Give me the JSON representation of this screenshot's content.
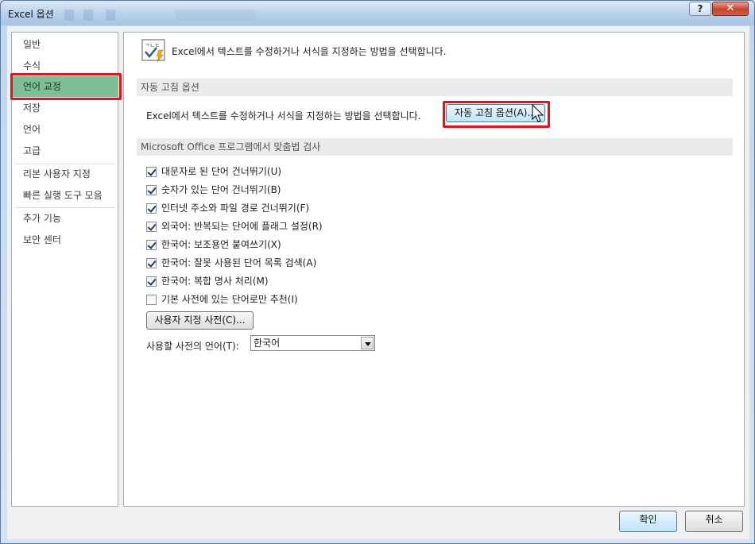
{
  "window": {
    "title": "Excel 옵션",
    "help_glyph": "?",
    "close_glyph": "✕"
  },
  "nav": {
    "items": [
      {
        "label": "일반"
      },
      {
        "label": "수식"
      },
      {
        "label": "언어 교정",
        "selected": true
      },
      {
        "label": "저장"
      },
      {
        "label": "언어"
      },
      {
        "label": "고급"
      },
      {
        "label": "리본 사용자 지정"
      },
      {
        "label": "빠른 실행 도구 모음"
      },
      {
        "label": "추가 기능"
      },
      {
        "label": "보안 센터"
      }
    ]
  },
  "main": {
    "header_text": "Excel에서 텍스트를 수정하거나 서식을 지정하는 방법을 선택합니다.",
    "header_icon": "abc-checkmark-icon",
    "autocorrect_section": {
      "title": "자동 고침 옵션",
      "description": "Excel에서 텍스트를 수정하거나 서식을 지정하는 방법을 선택합니다.",
      "button_label": "자동 고침 옵션(A)..."
    },
    "spelling_section": {
      "title": "Microsoft Office 프로그램에서 맞춤법 검사",
      "options": [
        {
          "label": "대문자로 된 단어 건너뛰기(U)",
          "checked": true
        },
        {
          "label": "숫자가 있는 단어 건너뛰기(B)",
          "checked": true
        },
        {
          "label": "인터넷 주소와 파일 경로 건너뛰기(F)",
          "checked": true
        },
        {
          "label": "외국어: 반복되는 단어에 플래그 설정(R)",
          "checked": true
        },
        {
          "label": "한국어: 보조용언 붙여쓰기(X)",
          "checked": true
        },
        {
          "label": "한국어: 잘못 사용된 단어 목록 검색(A)",
          "checked": true
        },
        {
          "label": "한국어: 복합 명사 처리(M)",
          "checked": true
        },
        {
          "label": "기본 사전에 있는 단어로만 추천(I)",
          "checked": false
        }
      ],
      "custom_dict_button": "사용자 지정 사전(C)...",
      "dict_language_label": "사용할 사전의 언어(T):",
      "dict_language_value": "한국어"
    }
  },
  "footer": {
    "ok_label": "확인",
    "cancel_label": "취소"
  }
}
